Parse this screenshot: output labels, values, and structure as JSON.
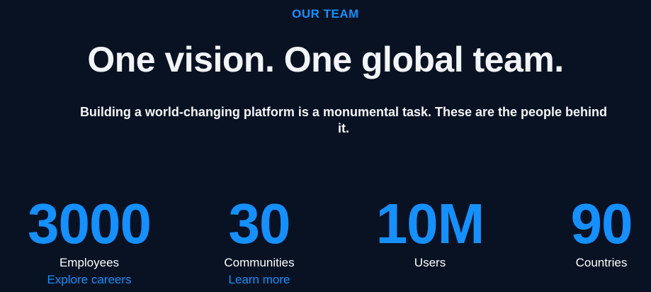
{
  "section": {
    "eyebrow": "OUR TEAM",
    "headline": "One vision. One global team.",
    "subheadline": "Building a world-changing platform is a monumental task. These are the people behind it."
  },
  "stats": [
    {
      "value": "3000",
      "label": "Employees",
      "link": "Explore careers"
    },
    {
      "value": "30",
      "label": "Communities",
      "link": "Learn more"
    },
    {
      "value": "10M",
      "label": "Users"
    },
    {
      "value": "90",
      "label": "Countries"
    }
  ],
  "colors": {
    "background": "#081223",
    "accent": "#1690ff",
    "text": "#ffffff"
  }
}
